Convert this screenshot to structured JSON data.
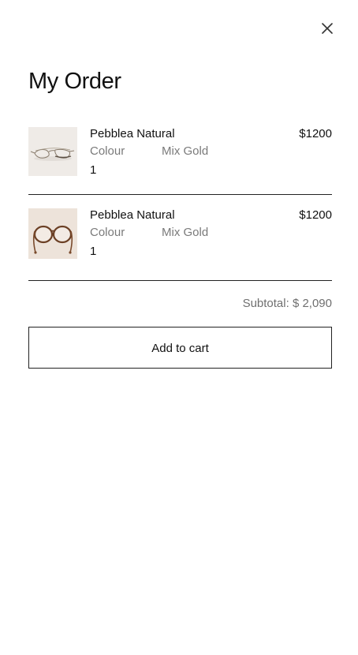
{
  "header": {
    "close_icon": "close-icon",
    "title": "My Order"
  },
  "order": {
    "items": [
      {
        "name": "Pebblea Natural",
        "price": "$1200",
        "attribute_label": "Colour",
        "attribute_value": "Mix Gold",
        "quantity": "1",
        "image_icon": "eyeglasses-gold-aviator"
      },
      {
        "name": "Pebblea Natural",
        "price": "$1200",
        "attribute_label": "Colour",
        "attribute_value": "Mix Gold",
        "quantity": "1",
        "image_icon": "eyeglasses-tortoise-round"
      }
    ],
    "subtotal": "Subtotal: $ 2,090"
  },
  "actions": {
    "add_to_cart_label": "Add to cart"
  },
  "colors": {
    "text": "#111111",
    "muted_text": "#7a7a7a",
    "divider": "#222222",
    "background": "#ffffff"
  }
}
